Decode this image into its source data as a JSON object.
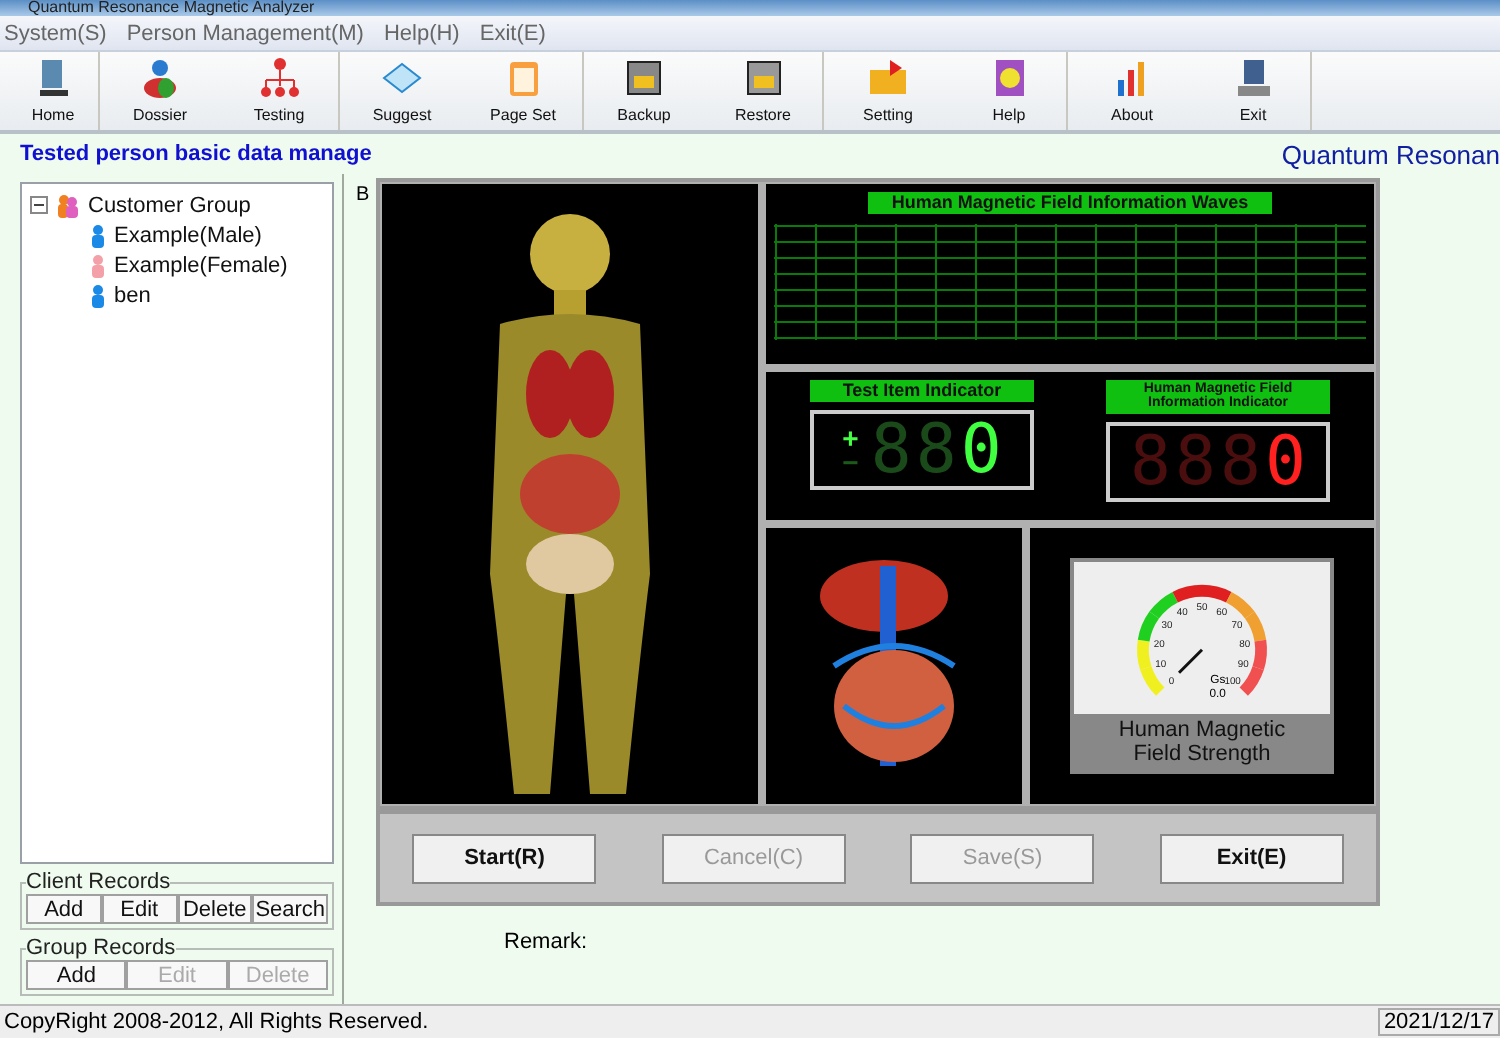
{
  "window": {
    "title": "Quantum Resonance Magnetic Analyzer"
  },
  "menu": [
    "System(S)",
    "Person Management(M)",
    "Help(H)",
    "Exit(E)"
  ],
  "toolbar": [
    {
      "label": "Home"
    },
    {
      "label": "Dossier"
    },
    {
      "label": "Testing"
    },
    {
      "label": "Suggest"
    },
    {
      "label": "Page Set"
    },
    {
      "label": "Backup"
    },
    {
      "label": "Restore"
    },
    {
      "label": "Setting"
    },
    {
      "label": "Help"
    },
    {
      "label": "About"
    },
    {
      "label": "Exit"
    }
  ],
  "header": {
    "title": "Tested person basic data manage",
    "brand": "Quantum Resonan"
  },
  "tree": {
    "label": "Customer Group",
    "expanded": true,
    "children": [
      {
        "label": "Example(Male)",
        "color": "#1a8ae6"
      },
      {
        "label": "Example(Female)",
        "color": "#f4a0a8"
      },
      {
        "label": "ben",
        "color": "#1a8ae6"
      }
    ]
  },
  "client_records": {
    "title": "Client Records",
    "buttons": [
      {
        "label": "Add",
        "disabled": false
      },
      {
        "label": "Edit",
        "disabled": false
      },
      {
        "label": "Delete",
        "disabled": false
      },
      {
        "label": "Search",
        "disabled": false
      }
    ]
  },
  "group_records": {
    "title": "Group Records",
    "buttons": [
      {
        "label": "Add",
        "disabled": false
      },
      {
        "label": "Edit",
        "disabled": true
      },
      {
        "label": "Delete",
        "disabled": true
      }
    ]
  },
  "panel_label": "B",
  "waves": {
    "title": "Human Magnetic Field Information Waves"
  },
  "test_item_indicator": {
    "title": "Test Item Indicator",
    "plus": "+",
    "minus": "−",
    "digits": [
      {
        "text": "8",
        "lit": false
      },
      {
        "text": "8",
        "lit": false
      },
      {
        "text": "0",
        "lit": true
      }
    ]
  },
  "field_indicator": {
    "title": "Human Magnetic Field Information Indicator",
    "digits": [
      {
        "text": "8",
        "lit": false
      },
      {
        "text": "8",
        "lit": false
      },
      {
        "text": "8",
        "lit": false
      },
      {
        "text": "0",
        "lit": true
      }
    ]
  },
  "gauge": {
    "caption": "Human Magnetic Field Strength",
    "unit": "Gs",
    "reading": "0.0",
    "ticks": [
      "0",
      "10",
      "20",
      "30",
      "40",
      "50",
      "60",
      "70",
      "80",
      "90",
      "100"
    ]
  },
  "actions": [
    {
      "label": "Start(R)",
      "disabled": false
    },
    {
      "label": "Cancel(C)",
      "disabled": true
    },
    {
      "label": "Save(S)",
      "disabled": true
    },
    {
      "label": "Exit(E)",
      "disabled": false
    }
  ],
  "remark": {
    "label": "Remark:"
  },
  "status_bar": {
    "copyright": "CopyRight 2008-2012, All Rights Reserved.",
    "date": "2021/12/17"
  }
}
